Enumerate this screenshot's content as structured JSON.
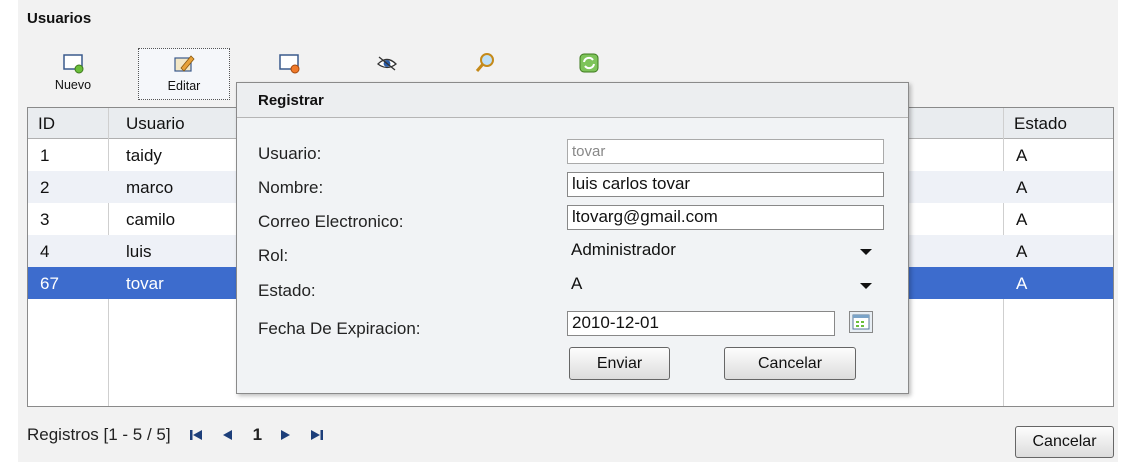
{
  "panel": {
    "title": "Usuarios"
  },
  "toolbar": {
    "new_label": "Nuevo",
    "edit_label": "Editar"
  },
  "grid": {
    "columns": {
      "id": "ID",
      "user": "Usuario",
      "state": "Estado"
    },
    "rows": [
      {
        "id": "1",
        "user": "taidy",
        "state": "A"
      },
      {
        "id": "2",
        "user": "marco",
        "state": "A"
      },
      {
        "id": "3",
        "user": "camilo",
        "state": "A"
      },
      {
        "id": "4",
        "user": "luis",
        "state": "A"
      },
      {
        "id": "67",
        "user": "tovar",
        "state": "A"
      }
    ]
  },
  "pager": {
    "summary": "Registros [1 - 5 / 5]",
    "page": "1"
  },
  "footer": {
    "cancel_label": "Cancelar"
  },
  "dialog": {
    "title": "Registrar",
    "labels": {
      "user": "Usuario:",
      "name": "Nombre:",
      "email": "Correo Electronico:",
      "role": "Rol:",
      "state": "Estado:",
      "expiry": "Fecha De Expiracion:"
    },
    "values": {
      "user": "tovar",
      "name": "luis carlos tovar",
      "email": "ltovarg@gmail.com",
      "role": "Administrador",
      "state": "A",
      "expiry": "2010-12-01"
    },
    "submit_label": "Enviar",
    "cancel_label": "Cancelar"
  },
  "colors": {
    "selection": "#3d6ccd",
    "alt_row": "#eef1f7",
    "panel_bg": "#f2f2f2"
  }
}
